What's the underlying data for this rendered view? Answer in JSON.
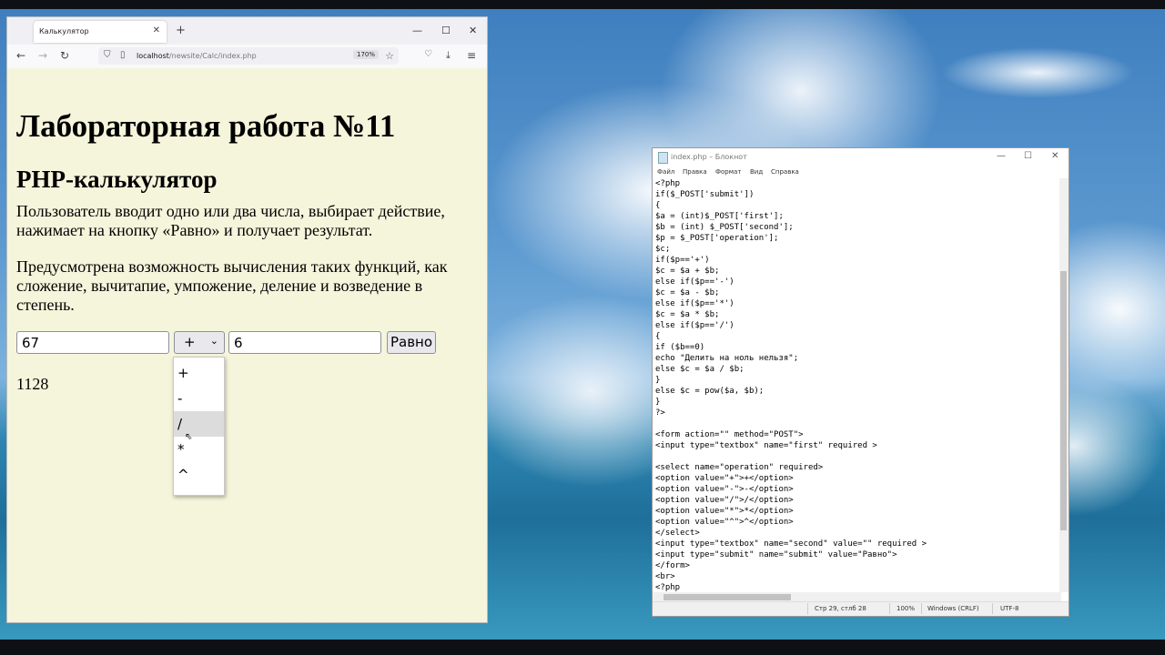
{
  "browser": {
    "tab_title": "Калькулятор",
    "tab_close": "✕",
    "new_tab": "+",
    "url_host": "localhost",
    "url_path": "/newsite/Calc/index.php",
    "zoom": "170%",
    "win_minimize": "—",
    "win_maximize": "☐",
    "win_close": "✕",
    "nav_back": "←",
    "nav_forward": "→",
    "nav_reload": "↻"
  },
  "page": {
    "h1": "Лабораторная работа №11",
    "h2": "PHP-калькулятор",
    "p1": "Пользователь вводит одно или два числа, выбирает действие, нажимает на кнопку «Равно» и получает результат.",
    "p2": "Предусмотрена возможность вычисления таких функций, как сложение, вычитапие, умпожение, деление и возведение в степень.",
    "first_value": "67",
    "operation_value": "+",
    "second_value": "6",
    "submit_label": "Равно",
    "result": "1128",
    "dropdown_options": [
      "+",
      "-",
      "/",
      "*",
      "^"
    ],
    "dropdown_hover_index": 2
  },
  "notepad": {
    "title": "index.php – Блокнот",
    "menu": [
      "Файл",
      "Правка",
      "Формат",
      "Вид",
      "Справка"
    ],
    "code_lines": [
      "<?php",
      "if($_POST['submit'])",
      "{",
      "$a = (int)$_POST['first'];",
      "$b = (int) $_POST['second'];",
      "$p = $_POST['operation'];",
      "$c;",
      "if($p=='+')",
      "$c = $a + $b;",
      "else if($p=='-')",
      "$c = $a - $b;",
      "else if($p=='*')",
      "$c = $a * $b;",
      "else if($p=='/')",
      "{",
      "if ($b==0)",
      "echo \"Делить на ноль нельзя\";",
      "else $c = $a / $b;",
      "}",
      "else $c = pow($a, $b);",
      "}",
      "?>",
      "",
      "<form action=\"\" method=\"POST\">",
      "<input type=\"textbox\" name=\"first\" required >",
      "",
      "<select name=\"operation\" required>",
      "<option value=\"+\">+</option>",
      "<option value=\"-\">-</option>",
      "<option value=\"/\">/</option>",
      "<option value=\"*\">*</option>",
      "<option value=\"^\">^</option>",
      "</select>",
      "<input type=\"textbox\" name=\"second\" value=\"\" required >",
      "<input type=\"submit\" name=\"submit\" value=\"Равно\">",
      "</form>",
      "<br>",
      "<?php"
    ],
    "status_position": "Стр 29, стлб 28",
    "status_zoom": "100%",
    "status_eol": "Windows (CRLF)",
    "status_encoding": "UTF-8"
  }
}
